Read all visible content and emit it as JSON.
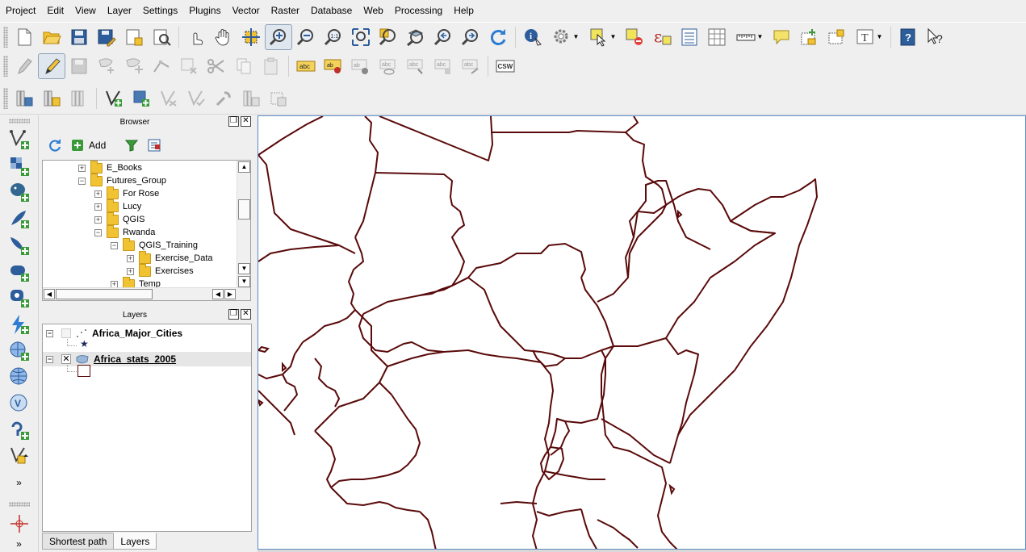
{
  "menu": [
    "Project",
    "Edit",
    "View",
    "Layer",
    "Settings",
    "Plugins",
    "Vector",
    "Raster",
    "Database",
    "Web",
    "Processing",
    "Help"
  ],
  "toolbar": {
    "icons_row1": [
      "new-project-icon",
      "open-project-icon",
      "save-project-icon",
      "save-as-icon",
      "new-print-composer-icon",
      "composer-manager-icon",
      "touch-zoom-icon",
      "pan-icon",
      "pan-to-selection-icon",
      "zoom-in-icon",
      "zoom-out-icon",
      "zoom-actual-icon",
      "zoom-full-icon",
      "zoom-to-selection-icon",
      "zoom-to-layer-icon",
      "zoom-last-icon",
      "zoom-next-icon",
      "refresh-icon",
      "identify-icon",
      "run-feature-action-icon",
      "select-features-icon",
      "deselect-icon",
      "expression-select-icon",
      "attribute-table-icon",
      "field-calculator-icon",
      "measure-icon",
      "map-tips-icon",
      "new-bookmark-icon",
      "show-bookmarks-icon",
      "text-annotation-icon",
      "help-contents-icon",
      "whats-this-icon"
    ],
    "csw_label": "CSW",
    "label_tool_text": "abc"
  },
  "browser": {
    "title": "Browser",
    "add_label": "Add",
    "tree": [
      {
        "label": "E_Books",
        "indent": 0,
        "expander": "+"
      },
      {
        "label": "Futures_Group",
        "indent": 0,
        "expander": "−"
      },
      {
        "label": "For Rose",
        "indent": 1,
        "expander": "+"
      },
      {
        "label": "Lucy",
        "indent": 1,
        "expander": "+"
      },
      {
        "label": "QGIS",
        "indent": 1,
        "expander": "+"
      },
      {
        "label": "Rwanda",
        "indent": 1,
        "expander": "−"
      },
      {
        "label": "QGIS_Training",
        "indent": 2,
        "expander": "−"
      },
      {
        "label": "Exercise_Data",
        "indent": 3,
        "expander": "+"
      },
      {
        "label": "Exercises",
        "indent": 3,
        "expander": "+"
      },
      {
        "label": "Temp",
        "indent": 1,
        "expander": "+"
      }
    ]
  },
  "layers": {
    "title": "Layers",
    "items": [
      {
        "name": "Africa_Major_Cities",
        "checked": false,
        "type": "point"
      },
      {
        "name": "Africa_stats_2005",
        "checked": true,
        "type": "polygon"
      }
    ],
    "check_mark": "✕"
  },
  "tabs": [
    "Shortest path",
    "Layers"
  ],
  "dock_buttons": {
    "float": "❐",
    "close": "✕"
  },
  "colors": {
    "boundary": "#5a0a0a",
    "map_border": "#5b8ac4",
    "folder": "#f1c232"
  }
}
